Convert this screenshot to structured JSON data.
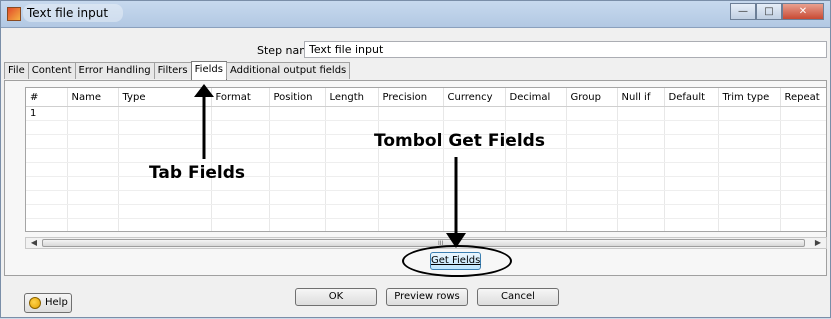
{
  "window": {
    "title": "Text file input",
    "controls": [
      "minimize",
      "maximize",
      "close"
    ]
  },
  "step_name": {
    "label": "Step name",
    "value": "Text file input"
  },
  "tabs": [
    {
      "label": "File",
      "active": false
    },
    {
      "label": "Content",
      "active": false
    },
    {
      "label": "Error Handling",
      "active": false
    },
    {
      "label": "Filters",
      "active": false
    },
    {
      "label": "Fields",
      "active": true
    },
    {
      "label": "Additional output fields",
      "active": false
    }
  ],
  "fields_table": {
    "columns": [
      "#",
      "Name",
      "Type",
      "Format",
      "Position",
      "Length",
      "Precision",
      "Currency",
      "Decimal",
      "Group",
      "Null if",
      "Default",
      "Trim type",
      "Repeat"
    ],
    "rows": [
      [
        "1",
        "",
        "",
        "",
        "",
        "",
        "",
        "",
        "",
        "",
        "",
        "",
        "",
        ""
      ],
      [
        "",
        "",
        "",
        "",
        "",
        "",
        "",
        "",
        "",
        "",
        "",
        "",
        "",
        ""
      ],
      [
        "",
        "",
        "",
        "",
        "",
        "",
        "",
        "",
        "",
        "",
        "",
        "",
        "",
        ""
      ],
      [
        "",
        "",
        "",
        "",
        "",
        "",
        "",
        "",
        "",
        "",
        "",
        "",
        "",
        ""
      ],
      [
        "",
        "",
        "",
        "",
        "",
        "",
        "",
        "",
        "",
        "",
        "",
        "",
        "",
        ""
      ],
      [
        "",
        "",
        "",
        "",
        "",
        "",
        "",
        "",
        "",
        "",
        "",
        "",
        "",
        ""
      ],
      [
        "",
        "",
        "",
        "",
        "",
        "",
        "",
        "",
        "",
        "",
        "",
        "",
        "",
        ""
      ],
      [
        "",
        "",
        "",
        "",
        "",
        "",
        "",
        "",
        "",
        "",
        "",
        "",
        "",
        ""
      ],
      [
        "",
        "",
        "",
        "",
        "",
        "",
        "",
        "",
        "",
        "",
        "",
        "",
        "",
        ""
      ]
    ]
  },
  "buttons": {
    "get_fields": "Get Fields",
    "help": "Help",
    "ok": "OK",
    "preview_rows": "Preview rows",
    "cancel": "Cancel"
  },
  "annotations": {
    "tab_fields": "Tab Fields",
    "get_fields": "Tombol Get Fields"
  },
  "scrollbar_grip": "III"
}
